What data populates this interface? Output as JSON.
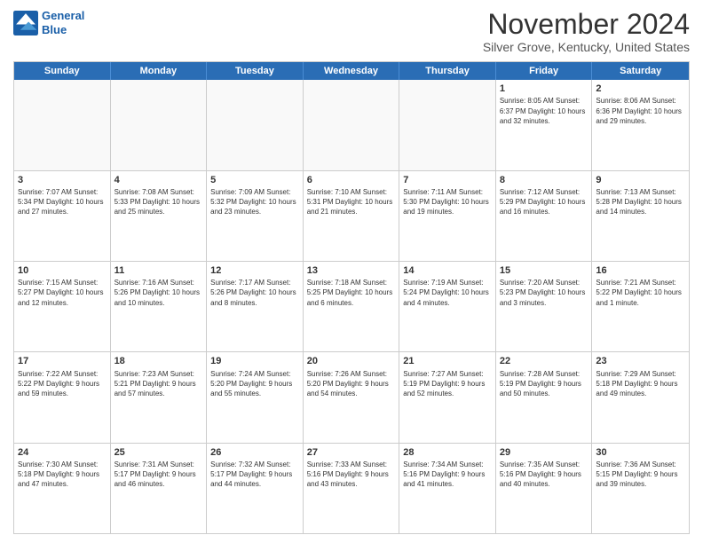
{
  "header": {
    "logo_line1": "General",
    "logo_line2": "Blue",
    "month": "November 2024",
    "location": "Silver Grove, Kentucky, United States"
  },
  "days_of_week": [
    "Sunday",
    "Monday",
    "Tuesday",
    "Wednesday",
    "Thursday",
    "Friday",
    "Saturday"
  ],
  "rows": [
    [
      {
        "day": "",
        "info": "",
        "empty": true
      },
      {
        "day": "",
        "info": "",
        "empty": true
      },
      {
        "day": "",
        "info": "",
        "empty": true
      },
      {
        "day": "",
        "info": "",
        "empty": true
      },
      {
        "day": "",
        "info": "",
        "empty": true
      },
      {
        "day": "1",
        "info": "Sunrise: 8:05 AM\nSunset: 6:37 PM\nDaylight: 10 hours\nand 32 minutes.",
        "empty": false
      },
      {
        "day": "2",
        "info": "Sunrise: 8:06 AM\nSunset: 6:36 PM\nDaylight: 10 hours\nand 29 minutes.",
        "empty": false
      }
    ],
    [
      {
        "day": "3",
        "info": "Sunrise: 7:07 AM\nSunset: 5:34 PM\nDaylight: 10 hours\nand 27 minutes.",
        "empty": false
      },
      {
        "day": "4",
        "info": "Sunrise: 7:08 AM\nSunset: 5:33 PM\nDaylight: 10 hours\nand 25 minutes.",
        "empty": false
      },
      {
        "day": "5",
        "info": "Sunrise: 7:09 AM\nSunset: 5:32 PM\nDaylight: 10 hours\nand 23 minutes.",
        "empty": false
      },
      {
        "day": "6",
        "info": "Sunrise: 7:10 AM\nSunset: 5:31 PM\nDaylight: 10 hours\nand 21 minutes.",
        "empty": false
      },
      {
        "day": "7",
        "info": "Sunrise: 7:11 AM\nSunset: 5:30 PM\nDaylight: 10 hours\nand 19 minutes.",
        "empty": false
      },
      {
        "day": "8",
        "info": "Sunrise: 7:12 AM\nSunset: 5:29 PM\nDaylight: 10 hours\nand 16 minutes.",
        "empty": false
      },
      {
        "day": "9",
        "info": "Sunrise: 7:13 AM\nSunset: 5:28 PM\nDaylight: 10 hours\nand 14 minutes.",
        "empty": false
      }
    ],
    [
      {
        "day": "10",
        "info": "Sunrise: 7:15 AM\nSunset: 5:27 PM\nDaylight: 10 hours\nand 12 minutes.",
        "empty": false
      },
      {
        "day": "11",
        "info": "Sunrise: 7:16 AM\nSunset: 5:26 PM\nDaylight: 10 hours\nand 10 minutes.",
        "empty": false
      },
      {
        "day": "12",
        "info": "Sunrise: 7:17 AM\nSunset: 5:26 PM\nDaylight: 10 hours\nand 8 minutes.",
        "empty": false
      },
      {
        "day": "13",
        "info": "Sunrise: 7:18 AM\nSunset: 5:25 PM\nDaylight: 10 hours\nand 6 minutes.",
        "empty": false
      },
      {
        "day": "14",
        "info": "Sunrise: 7:19 AM\nSunset: 5:24 PM\nDaylight: 10 hours\nand 4 minutes.",
        "empty": false
      },
      {
        "day": "15",
        "info": "Sunrise: 7:20 AM\nSunset: 5:23 PM\nDaylight: 10 hours\nand 3 minutes.",
        "empty": false
      },
      {
        "day": "16",
        "info": "Sunrise: 7:21 AM\nSunset: 5:22 PM\nDaylight: 10 hours\nand 1 minute.",
        "empty": false
      }
    ],
    [
      {
        "day": "17",
        "info": "Sunrise: 7:22 AM\nSunset: 5:22 PM\nDaylight: 9 hours\nand 59 minutes.",
        "empty": false
      },
      {
        "day": "18",
        "info": "Sunrise: 7:23 AM\nSunset: 5:21 PM\nDaylight: 9 hours\nand 57 minutes.",
        "empty": false
      },
      {
        "day": "19",
        "info": "Sunrise: 7:24 AM\nSunset: 5:20 PM\nDaylight: 9 hours\nand 55 minutes.",
        "empty": false
      },
      {
        "day": "20",
        "info": "Sunrise: 7:26 AM\nSunset: 5:20 PM\nDaylight: 9 hours\nand 54 minutes.",
        "empty": false
      },
      {
        "day": "21",
        "info": "Sunrise: 7:27 AM\nSunset: 5:19 PM\nDaylight: 9 hours\nand 52 minutes.",
        "empty": false
      },
      {
        "day": "22",
        "info": "Sunrise: 7:28 AM\nSunset: 5:19 PM\nDaylight: 9 hours\nand 50 minutes.",
        "empty": false
      },
      {
        "day": "23",
        "info": "Sunrise: 7:29 AM\nSunset: 5:18 PM\nDaylight: 9 hours\nand 49 minutes.",
        "empty": false
      }
    ],
    [
      {
        "day": "24",
        "info": "Sunrise: 7:30 AM\nSunset: 5:18 PM\nDaylight: 9 hours\nand 47 minutes.",
        "empty": false
      },
      {
        "day": "25",
        "info": "Sunrise: 7:31 AM\nSunset: 5:17 PM\nDaylight: 9 hours\nand 46 minutes.",
        "empty": false
      },
      {
        "day": "26",
        "info": "Sunrise: 7:32 AM\nSunset: 5:17 PM\nDaylight: 9 hours\nand 44 minutes.",
        "empty": false
      },
      {
        "day": "27",
        "info": "Sunrise: 7:33 AM\nSunset: 5:16 PM\nDaylight: 9 hours\nand 43 minutes.",
        "empty": false
      },
      {
        "day": "28",
        "info": "Sunrise: 7:34 AM\nSunset: 5:16 PM\nDaylight: 9 hours\nand 41 minutes.",
        "empty": false
      },
      {
        "day": "29",
        "info": "Sunrise: 7:35 AM\nSunset: 5:16 PM\nDaylight: 9 hours\nand 40 minutes.",
        "empty": false
      },
      {
        "day": "30",
        "info": "Sunrise: 7:36 AM\nSunset: 5:15 PM\nDaylight: 9 hours\nand 39 minutes.",
        "empty": false
      }
    ]
  ]
}
